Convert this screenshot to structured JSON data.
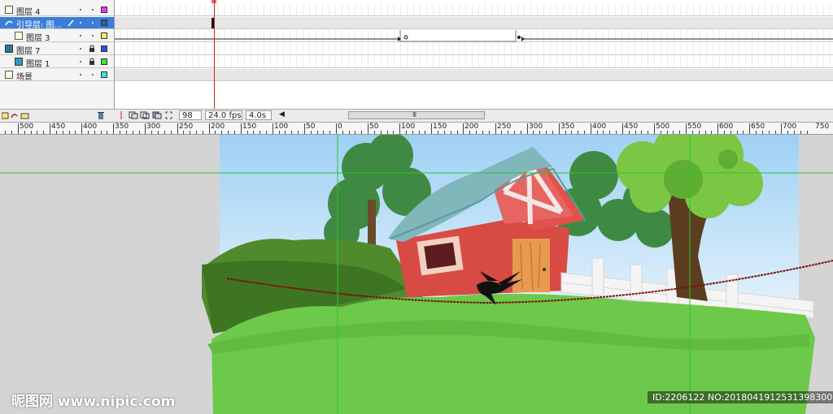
{
  "timeline": {
    "layers": [
      {
        "name": "图层 4",
        "type": "normal",
        "swatch": "#e040e0",
        "locked": false,
        "selected": false
      },
      {
        "name": "引导层: 图...",
        "type": "guide",
        "swatch": "#3a5a9a",
        "locked": false,
        "selected": true
      },
      {
        "name": "图层 3",
        "type": "guided",
        "swatch": "#f0f060",
        "locked": false,
        "selected": false
      },
      {
        "name": "图层 7",
        "type": "mask",
        "swatch": "#3050e0",
        "locked": true,
        "selected": false
      },
      {
        "name": "图层 1",
        "type": "masked",
        "swatch": "#40e040",
        "locked": true,
        "selected": false
      },
      {
        "name": "场景",
        "type": "normal",
        "swatch": "#40e0e0",
        "locked": false,
        "selected": false
      }
    ]
  },
  "statusbar": {
    "current_frame": "98",
    "frame_rate": "24.0 fps",
    "elapsed_time": "4.0s",
    "scroll_grip": "III"
  },
  "ruler": {
    "labels": [
      "500",
      "450",
      "400",
      "350",
      "300",
      "250",
      "200",
      "150",
      "100",
      "50",
      "0",
      "50",
      "100",
      "150",
      "200",
      "250",
      "300",
      "350",
      "400",
      "450",
      "500",
      "550",
      "600",
      "650",
      "700",
      "750"
    ]
  },
  "stage": {
    "colors": {
      "sky_top": "#9ed0f4",
      "sky_bottom": "#e8f4fb",
      "grass": "#6cc94a",
      "hill": "#4f8b2c",
      "barn": "#d84a44",
      "roof": "#7fb7bb",
      "guide_line": "#2fc32f",
      "rope": "#7a1010"
    }
  },
  "watermark": {
    "site": "昵图网 www.nipic.com",
    "id_text": "ID:2206122 NO:20180419125313983000"
  }
}
